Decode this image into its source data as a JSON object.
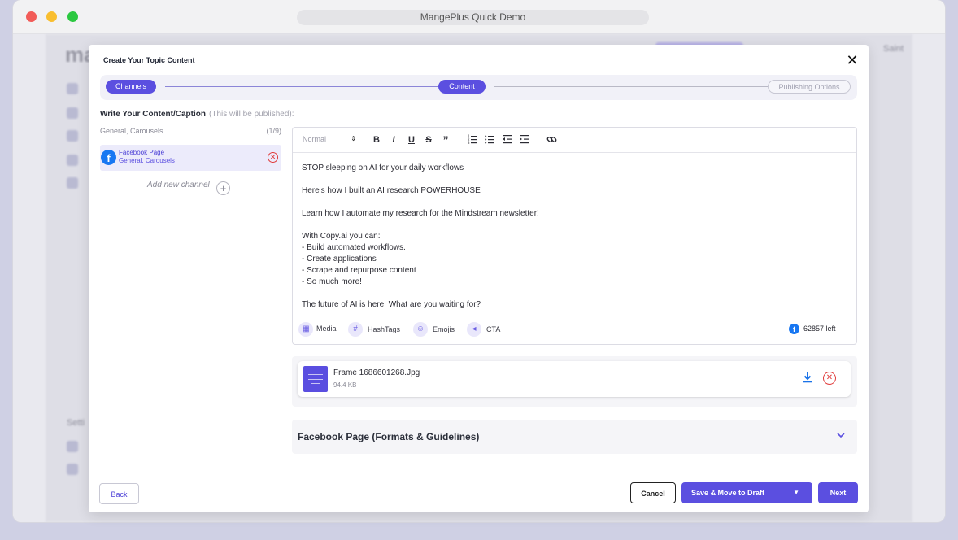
{
  "window": {
    "title": "MangePlus Quick Demo"
  },
  "background": {
    "logo": "ma",
    "settings_label": "Setti",
    "user_label": "Saint"
  },
  "modal": {
    "title": "Create Your Topic Content",
    "steps": [
      {
        "label": "Channels",
        "state": "active"
      },
      {
        "label": "Content",
        "state": "active"
      },
      {
        "label": "Publishing Options",
        "state": "inactive"
      }
    ],
    "write_label": "Write Your Content/Caption",
    "write_hint": "(This will be published):",
    "channel_group": {
      "label": "General, Carousels",
      "count": "(1/9)"
    },
    "channel": {
      "name": "Facebook Page",
      "sub": "General, Carousels",
      "icon": "facebook-icon"
    },
    "add_channel": "Add new channel",
    "toolbar": {
      "format_select": "Normal",
      "buttons": [
        "bold",
        "italic",
        "underline",
        "strikethrough",
        "quote",
        "ordered-list",
        "bullet-list",
        "outdent",
        "indent",
        "link"
      ]
    },
    "content_lines": [
      "STOP sleeping on AI for your daily workflows",
      "",
      "Here's how I built an AI research POWERHOUSE",
      "",
      "Learn how I automate my research for the Mindstream newsletter!",
      "",
      "With Copy.ai you can:",
      "- Build automated workflows.",
      "- Create applications",
      "- Scrape and repurpose content",
      "- So much more!",
      "",
      "The future of AI is here. What are you waiting for?"
    ],
    "editor_footer": {
      "media": "Media",
      "hashtags": "HashTags",
      "emojis": "Emojis",
      "cta": "CTA",
      "chars_left": "62857 left"
    },
    "media_file": {
      "name": "Frame 1686601268.Jpg",
      "size": "94.4 KB"
    },
    "guidelines_title": "Facebook Page (Formats & Guidelines)",
    "buttons": {
      "back": "Back",
      "cancel": "Cancel",
      "save_draft": "Save & Move to Draft",
      "next": "Next"
    }
  },
  "colors": {
    "accent": "#5b4fe0",
    "facebook": "#1877f2",
    "danger": "#e03b3b"
  }
}
